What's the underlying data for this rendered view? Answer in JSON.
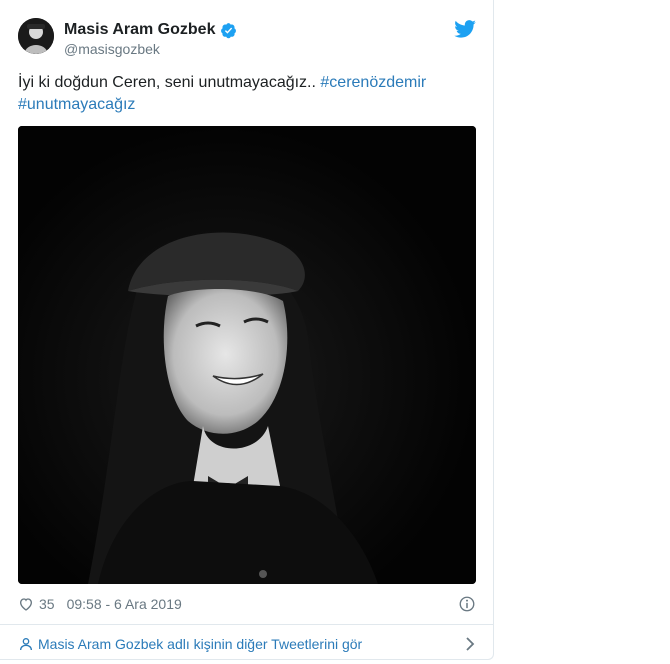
{
  "tweet": {
    "author_name": "Masis Aram Gozbek",
    "author_handle": "@masisgozbek",
    "text_plain": "İyi ki doğdun Ceren, seni unutmayacağız.. ",
    "hashtag_1": "#cerenözdemir",
    "hashtag_2": "#unutmayacağız",
    "like_count": "35",
    "timestamp": "09:58 - 6 Ara 2019",
    "more_tweets_label": "Masis Aram Gozbek adlı kişinin diğer Tweetlerini gör"
  },
  "icons": {
    "verified": "verified-badge-icon",
    "logo": "twitter-bird-icon",
    "like": "heart-icon",
    "info": "info-icon",
    "person": "person-icon",
    "chevron": "chevron-right-icon"
  },
  "colors": {
    "link": "#2b7bb9",
    "muted": "#697882",
    "brand": "#1da1f2",
    "text": "#1c2022"
  }
}
